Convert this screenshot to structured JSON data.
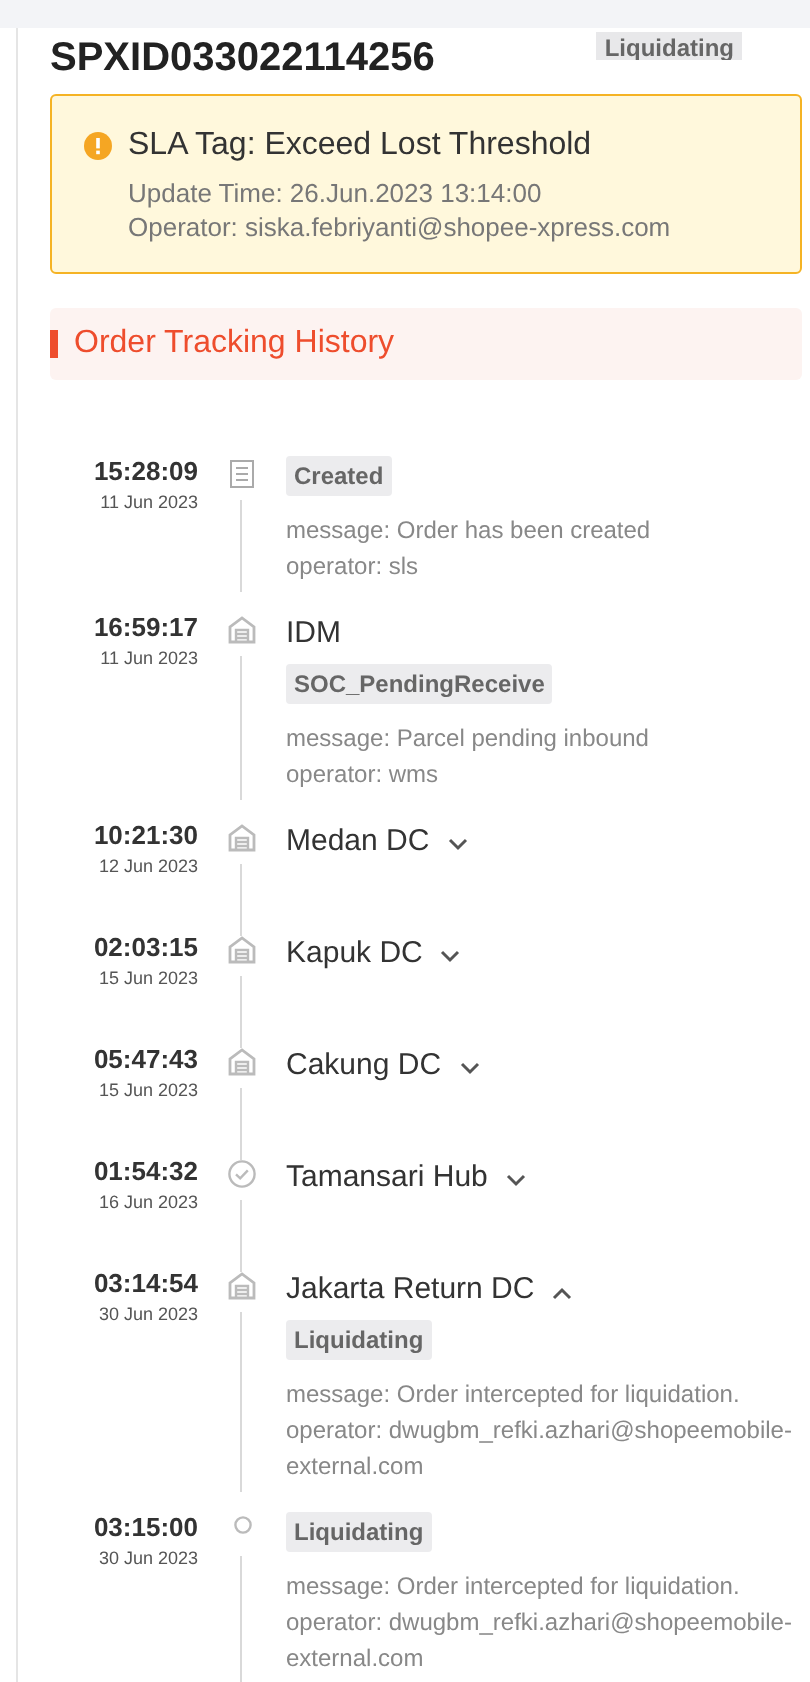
{
  "order_id": "SPXID033022114256",
  "status_badge": "Liquidating",
  "alert": {
    "title": "SLA Tag: Exceed Lost Threshold",
    "lines": [
      "Update Time: 26.Jun.2023 13:14:00",
      "Operator: siska.febriyanti@shopee-xpress.com"
    ]
  },
  "section_title": "Order Tracking History",
  "events": [
    {
      "time": "15:28:09",
      "date": "11 Jun 2023",
      "kind": "document",
      "badge": "Created",
      "details": [
        "message: Order has been created",
        "operator: sls"
      ]
    },
    {
      "time": "16:59:17",
      "date": "11 Jun 2023",
      "kind": "warehouse",
      "title": "IDM",
      "badge": "SOC_PendingReceive",
      "details": [
        "message: Parcel pending inbound",
        "operator: wms"
      ]
    },
    {
      "time": "10:21:30",
      "date": "12 Jun 2023",
      "kind": "warehouse",
      "title": "Medan DC",
      "expanded": false
    },
    {
      "time": "02:03:15",
      "date": "15 Jun 2023",
      "kind": "warehouse",
      "title": "Kapuk DC",
      "expanded": false
    },
    {
      "time": "05:47:43",
      "date": "15 Jun 2023",
      "kind": "warehouse",
      "title": "Cakung DC",
      "expanded": false
    },
    {
      "time": "01:54:32",
      "date": "16 Jun 2023",
      "kind": "check",
      "title": "Tamansari Hub",
      "expanded": false
    },
    {
      "time": "03:14:54",
      "date": "30 Jun 2023",
      "kind": "warehouse",
      "title": "Jakarta Return DC",
      "expanded": true,
      "badge": "Liquidating",
      "details": [
        "message: Order intercepted for liquidation.",
        "operator: dwugbm_refki.azhari@shopeemobile-external.com"
      ]
    },
    {
      "time": "03:15:00",
      "date": "30 Jun 2023",
      "kind": "dot",
      "badge": "Liquidating",
      "details": [
        "message: Order intercepted for liquidation.",
        "operator: dwugbm_refki.azhari@shopeemobile-external.com"
      ]
    }
  ]
}
